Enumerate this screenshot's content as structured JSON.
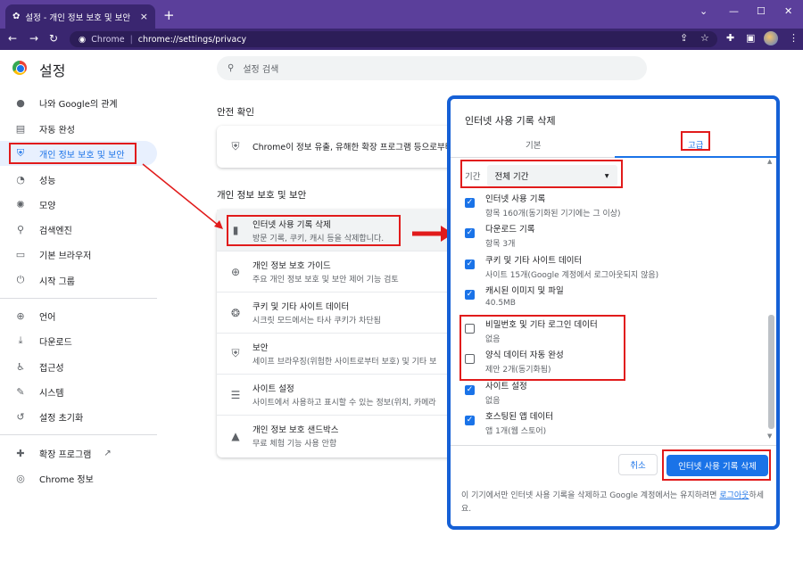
{
  "browser": {
    "tab_title": "설정 - 개인 정보 보호 및 보안",
    "tab_close": "×",
    "new_tab": "+",
    "url_host": "Chrome",
    "url_path": "chrome://settings/privacy"
  },
  "app": {
    "title": "설정",
    "search_placeholder": "설정 검색"
  },
  "sidebar": {
    "items": [
      {
        "label": "나와 Google의 관계"
      },
      {
        "label": "자동 완성"
      },
      {
        "label": "개인 정보 보호 및 보안"
      },
      {
        "label": "성능"
      },
      {
        "label": "모양"
      },
      {
        "label": "검색엔진"
      },
      {
        "label": "기본 브라우저"
      },
      {
        "label": "시작 그룹"
      },
      {
        "label": "언어"
      },
      {
        "label": "다운로드"
      },
      {
        "label": "접근성"
      },
      {
        "label": "시스템"
      },
      {
        "label": "설정 초기화"
      },
      {
        "label": "확장 프로그램"
      },
      {
        "label": "Chrome 정보"
      }
    ]
  },
  "main": {
    "safety_heading": "안전 확인",
    "safety_text": "Chrome이 정보 유출, 유해한 확장 프로그램 등으로부터",
    "privacy_heading": "개인 정보 보호 및 보안",
    "rows": [
      {
        "title": "인터넷 사용 기록 삭제",
        "desc": "방문 기록, 쿠키, 캐시 등을 삭제합니다."
      },
      {
        "title": "개인 정보 보호 가이드",
        "desc": "주요 개인 정보 보호 및 보안 제어 기능 검토"
      },
      {
        "title": "쿠키 및 기타 사이트 데이터",
        "desc": "시크릿 모드에서는 타사 쿠키가 차단됨"
      },
      {
        "title": "보안",
        "desc": "세이프 브라우징(위험한 사이트로부터 보호) 및 기타 보"
      },
      {
        "title": "사이트 설정",
        "desc": "사이트에서 사용하고 표시할 수 있는 정보(위치, 카메라"
      },
      {
        "title": "개인 정보 보호 샌드박스",
        "desc": "무료 체험 기능 사용 안함"
      }
    ]
  },
  "dialog": {
    "title": "인터넷 사용 기록 삭제",
    "tab_basic": "기본",
    "tab_advanced": "고급",
    "range_label": "기간",
    "range_value": "전체 기간",
    "items": [
      {
        "title": "인터넷 사용 기록",
        "desc": "항목 160개(동기화된 기기에는 그 이상)",
        "checked": true
      },
      {
        "title": "다운로드 기록",
        "desc": "항목 3개",
        "checked": true
      },
      {
        "title": "쿠키 및 기타 사이트 데이터",
        "desc": "사이트 15개(Google 계정에서 로그아웃되지 않음)",
        "checked": true
      },
      {
        "title": "캐시된 이미지 및 파일",
        "desc": "40.5MB",
        "checked": true
      },
      {
        "title": "비밀번호 및 기타 로그인 데이터",
        "desc": "없음",
        "checked": false
      },
      {
        "title": "양식 데이터 자동 완성",
        "desc": "제안 2개(동기화됨)",
        "checked": false
      },
      {
        "title": "사이트 설정",
        "desc": "없음",
        "checked": true
      },
      {
        "title": "호스팅된 앱 데이터",
        "desc": "앱 1개(웹 스토어)",
        "checked": true
      }
    ],
    "cancel": "취소",
    "delete": "인터넷 사용 기록 삭제",
    "footer_text": "이 기기에서만 인터넷 사용 기록을 삭제하고 Google 계정에서는 유지하려면 ",
    "footer_link": "로그아웃",
    "footer_end": "하세요."
  },
  "colors": {
    "accent": "#1a73e8",
    "frame": "#5b3f9b",
    "highlight": "#e11b1b",
    "dialog_border": "#1560d6"
  }
}
